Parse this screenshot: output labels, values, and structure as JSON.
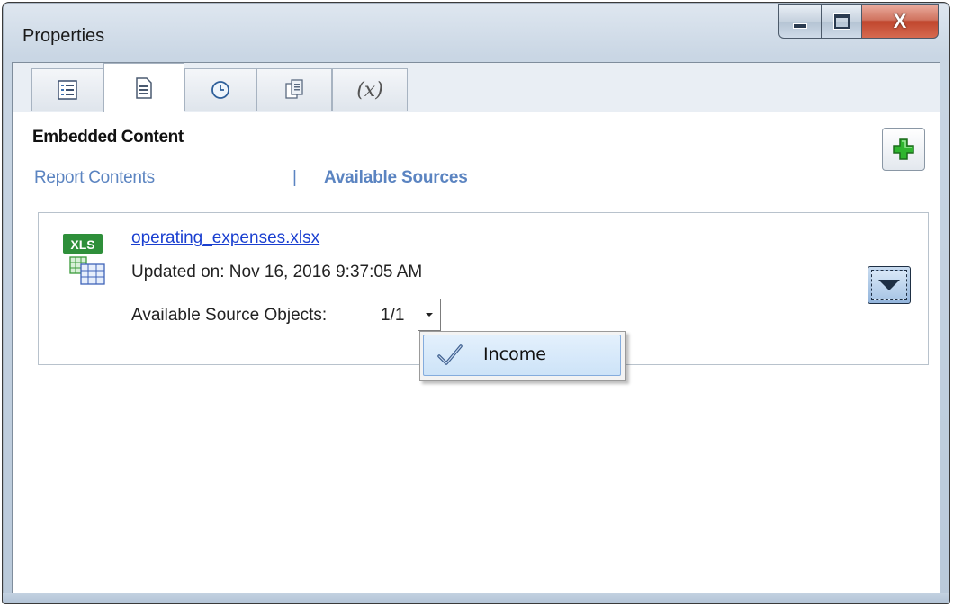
{
  "window": {
    "title": "Properties",
    "caption_buttons": [
      "minimize",
      "maximize",
      "close"
    ],
    "close_glyph": "X"
  },
  "tabs": [
    {
      "icon": "list-icon",
      "active": false
    },
    {
      "icon": "document-icon",
      "active": true
    },
    {
      "icon": "clock-icon",
      "active": false
    },
    {
      "icon": "page-copy-icon",
      "active": false
    },
    {
      "icon": "variable-icon",
      "label": "(x)",
      "active": false
    }
  ],
  "panel": {
    "heading": "Embedded Content",
    "subtabs": {
      "report_contents": "Report Contents",
      "separator": "|",
      "available_sources": "Available Sources"
    },
    "add_button_icon": "plus-icon",
    "source": {
      "file_icon_label": "XLS",
      "file_name": "operating_expenses.xlsx",
      "updated": "Updated on: Nov 16, 2016 9:37:05 AM",
      "objects_label": "Available Source Objects:",
      "objects_count": "1/1",
      "expand_icon": "triangle-down-icon"
    },
    "dropdown": {
      "items": [
        {
          "label": "Income",
          "checked": true
        }
      ]
    }
  },
  "colors": {
    "link_blue": "#1a3fd0",
    "subtab_blue": "#5b84c1",
    "close_red": "#c0462d"
  }
}
